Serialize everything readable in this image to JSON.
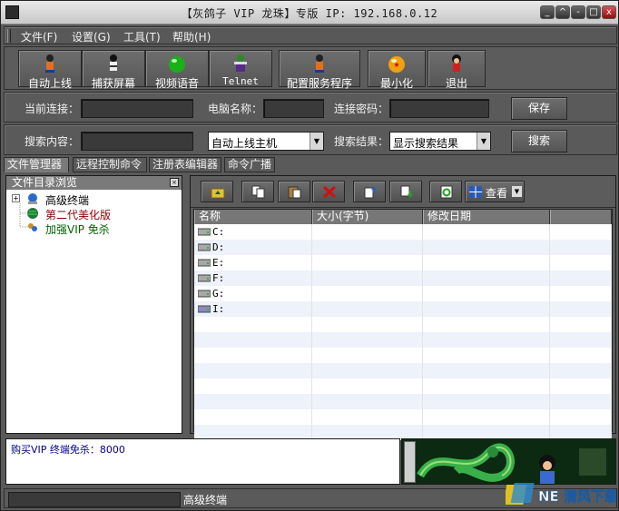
{
  "title": "【灰鸽子 VIP 龙珠】专版 IP: 192.168.0.12",
  "window_buttons": [
    "_",
    "^",
    "-",
    "□",
    "x"
  ],
  "menu": [
    "文件(F)",
    "设置(G)",
    "工具(T)",
    "帮助(H)"
  ],
  "toolbar": [
    {
      "label": "自动上线",
      "icon": "goku-figure-icon"
    },
    {
      "label": "捕获屏幕",
      "icon": "character-figure-icon"
    },
    {
      "label": "视频语音",
      "icon": "green-orb-icon"
    },
    {
      "label": "Telnet",
      "icon": "piccolo-figure-icon"
    },
    {
      "label": "配置服务程序",
      "icon": "goku-figure-icon"
    },
    {
      "label": "最小化",
      "icon": "dragon-ball-icon"
    },
    {
      "label": "退出",
      "icon": "kid-goku-icon"
    }
  ],
  "connection": {
    "current_label": "当前连接：",
    "computer_label": "电脑名称：",
    "password_label": "连接密码：",
    "save": "保存"
  },
  "search": {
    "content_label": "搜索内容：",
    "mode": "自动上线主机",
    "result_label": "搜索结果：",
    "result_mode": "显示搜索结果",
    "button": "搜索"
  },
  "tabs": [
    "文件管理器",
    "远程控制命令",
    "注册表编辑器",
    "命令广播"
  ],
  "tree": {
    "header": "文件目录浏览",
    "items": [
      {
        "label": "高级终端",
        "color": "#000000"
      },
      {
        "label": "第二代美化版",
        "color": "#8b0000"
      },
      {
        "label": "加强VIP 免杀",
        "color": "#006400"
      }
    ]
  },
  "file_toolbar": {
    "view_label": "查看"
  },
  "file_list": {
    "columns": [
      "名称",
      "大小(字节)",
      "修改日期",
      ""
    ],
    "drives": [
      "C:",
      "D:",
      "E:",
      "F:",
      "G:",
      "I:"
    ]
  },
  "log_text": "购买VIP 终端免杀：8000",
  "status_text": "高级终端",
  "watermark_text": "NE 清风下载"
}
